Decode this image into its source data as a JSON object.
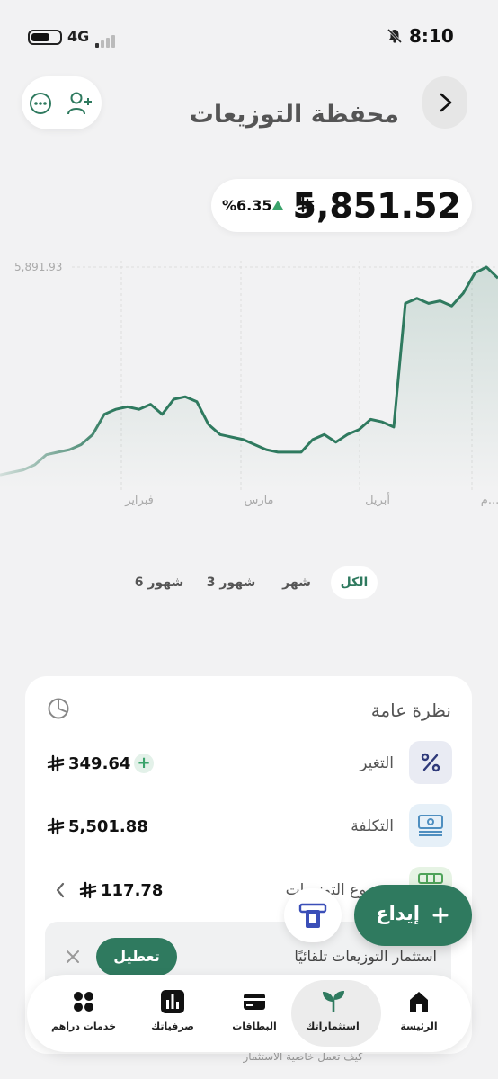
{
  "status_bar": {
    "time": "8:10",
    "network": "4G"
  },
  "header": {
    "title": "محفظة التوزيعات"
  },
  "balance": {
    "value": "5,851.52",
    "change_pct": "%6.35"
  },
  "colors": {
    "accent": "#2f7a5f",
    "positive": "#3aa36b",
    "card_bg": "#ffffff",
    "page_bg": "#f2f2f3"
  },
  "chart_data": {
    "type": "line",
    "series": [
      {
        "values": [
          5480,
          5485,
          5490,
          5500,
          5520,
          5525,
          5530,
          5540,
          5560,
          5600,
          5610,
          5615,
          5610,
          5620,
          5600,
          5630,
          5635,
          5625,
          5580,
          5560,
          5555,
          5550,
          5540,
          5530,
          5525,
          5525,
          5525,
          5550,
          5560,
          5545,
          5560,
          5570,
          5590,
          5585,
          5575,
          5820,
          5830,
          5820,
          5825,
          5815,
          5840,
          5880,
          5891.93,
          5870
        ]
      }
    ],
    "x_ticks": [
      "فبراير",
      "مارس",
      "أبريل",
      "م..."
    ],
    "y_max_label": "5,891.93",
    "grid": "vertical dashed"
  },
  "tabs": [
    {
      "label": "الكل",
      "active": true
    },
    {
      "label": "شهر"
    },
    {
      "label": "3 شهور"
    },
    {
      "label": "6 شهور"
    }
  ],
  "overview": {
    "title": "نظرة عامة",
    "rows": [
      {
        "label": "التغير",
        "value": "349.64",
        "icon": "percent-icon",
        "badge": "+"
      },
      {
        "label": "التكلفة",
        "value": "5,501.88",
        "icon": "cash-icon"
      },
      {
        "label": "مجموع التوزيعات",
        "value": "117.78",
        "icon": "grid-cash-icon"
      }
    ],
    "auto_invest": {
      "label": "استثمار التوزيعات تلقائيًا",
      "button": "تعطيل",
      "footer": "كيف تعمل خاصية الاستثمار"
    }
  },
  "fab": {
    "label": "إيداع"
  },
  "bottom_nav": [
    {
      "label": "الرئيسة",
      "icon": "home-icon"
    },
    {
      "label": "استثماراتك",
      "icon": "sprout-icon",
      "active": true
    },
    {
      "label": "البطاقات",
      "icon": "card-icon"
    },
    {
      "label": "صرفياتك",
      "icon": "bar-chart-icon"
    },
    {
      "label": "خدمات دراهم",
      "icon": "dots-grid-icon"
    }
  ]
}
